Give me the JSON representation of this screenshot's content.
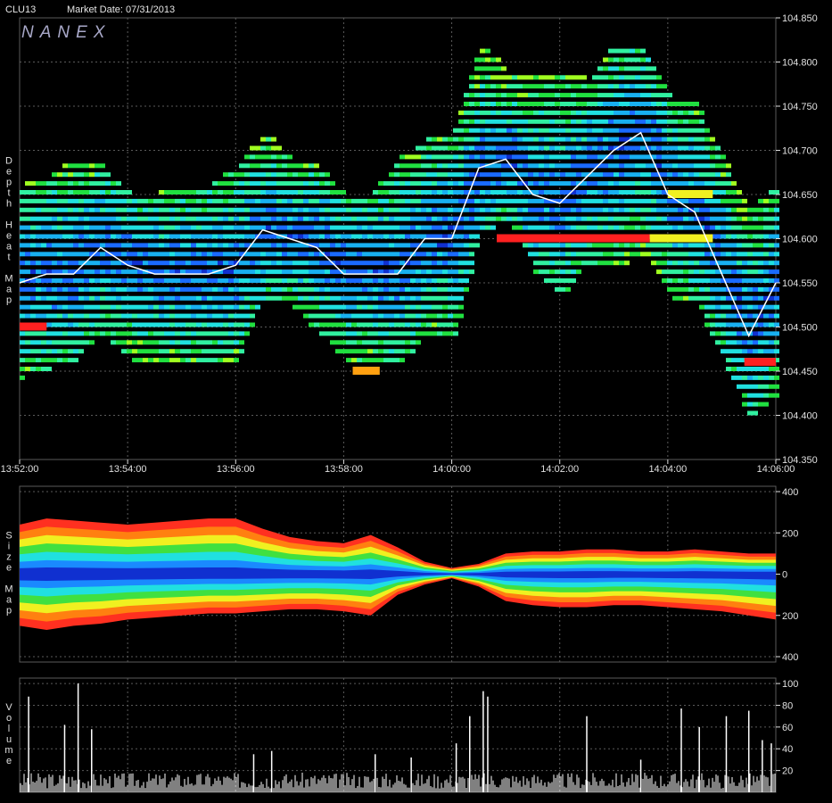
{
  "header": {
    "symbol": "CLU13",
    "market_date": "Market Date: 07/31/2013",
    "logo": "NANEX"
  },
  "colors": {
    "background": "#000000",
    "grid": "#5a5a5a",
    "axis_text": "#e0e0e0",
    "last_trade_line": "#ffffff",
    "heat_scale": [
      "#1030d0",
      "#1a6aff",
      "#18b0f0",
      "#20e0e0",
      "#30f0a0",
      "#20e040",
      "#a0ff20",
      "#f0f020",
      "#ffa010",
      "#ff2020"
    ]
  },
  "chart_data": [
    {
      "type": "heatmap",
      "panel": "depth",
      "ylabel": "Depth Heat Map",
      "ylim": [
        104.35,
        104.85
      ],
      "y_ticks": [
        "104.350",
        "104.400",
        "104.450",
        "104.500",
        "104.550",
        "104.600",
        "104.650",
        "104.700",
        "104.750",
        "104.800",
        "104.850"
      ],
      "x_ticks": [
        "13:52:00",
        "13:54:00",
        "13:56:00",
        "13:58:00",
        "14:00:00",
        "14:02:00",
        "14:04:00",
        "14:06:00"
      ],
      "last_trade_line": {
        "time": [
          "13:52:00",
          "13:52:30",
          "13:53:00",
          "13:53:30",
          "13:54:00",
          "13:54:30",
          "13:55:00",
          "13:55:30",
          "13:56:00",
          "13:56:30",
          "13:57:00",
          "13:57:30",
          "13:58:00",
          "13:58:30",
          "13:59:00",
          "13:59:30",
          "14:00:00",
          "14:00:30",
          "14:01:00",
          "14:01:30",
          "14:02:00",
          "14:02:30",
          "14:03:00",
          "14:03:30",
          "14:04:00",
          "14:04:30",
          "14:05:00",
          "14:05:30",
          "14:06:00"
        ],
        "price": [
          104.55,
          104.56,
          104.56,
          104.59,
          104.57,
          104.56,
          104.56,
          104.56,
          104.57,
          104.61,
          104.6,
          104.59,
          104.56,
          104.56,
          104.56,
          104.6,
          104.6,
          104.68,
          104.69,
          104.65,
          104.64,
          104.67,
          104.7,
          104.72,
          104.65,
          104.63,
          104.56,
          104.49,
          104.55
        ]
      },
      "depth_range": {
        "time": [
          "13:52:00",
          "13:52:30",
          "13:53:00",
          "13:53:30",
          "13:54:00",
          "13:54:30",
          "13:55:00",
          "13:55:30",
          "13:56:00",
          "13:56:30",
          "13:57:00",
          "13:57:30",
          "13:58:00",
          "13:58:30",
          "13:59:00",
          "13:59:30",
          "14:00:00",
          "14:00:30",
          "14:01:00",
          "14:01:30",
          "14:02:00",
          "14:02:30",
          "14:03:00",
          "14:03:30",
          "14:04:00",
          "14:04:30",
          "14:05:00",
          "14:05:30",
          "14:06:00"
        ],
        "low": [
          104.44,
          104.45,
          104.46,
          104.49,
          104.46,
          104.46,
          104.46,
          104.45,
          104.46,
          104.53,
          104.52,
          104.49,
          104.46,
          104.46,
          104.45,
          104.49,
          104.48,
          104.6,
          104.62,
          104.56,
          104.53,
          104.57,
          104.56,
          104.58,
          104.53,
          104.52,
          104.46,
          104.39,
          104.42
        ],
        "high": [
          104.66,
          104.67,
          104.69,
          104.68,
          104.65,
          104.65,
          104.66,
          104.66,
          104.68,
          104.72,
          104.69,
          104.68,
          104.65,
          104.65,
          104.69,
          104.71,
          104.72,
          104.82,
          104.79,
          104.78,
          104.79,
          104.78,
          104.82,
          104.81,
          104.76,
          104.75,
          104.69,
          104.63,
          104.66
        ]
      },
      "highlight_bands": [
        {
          "from": "13:52:00",
          "to": "13:52:30",
          "price": 104.5,
          "color": "#ff2020"
        },
        {
          "from": "13:58:10",
          "to": "13:58:40",
          "price": 104.45,
          "color": "#ffa010"
        },
        {
          "from": "14:00:50",
          "to": "14:03:40",
          "price": 104.6,
          "color": "#ff2020"
        },
        {
          "from": "14:03:40",
          "to": "14:04:50",
          "price": 104.6,
          "color": "#f0f020"
        },
        {
          "from": "14:04:00",
          "to": "14:04:50",
          "price": 104.65,
          "color": "#f0f020"
        },
        {
          "from": "14:05:25",
          "to": "14:06:00",
          "price": 104.46,
          "color": "#ff2020"
        }
      ]
    },
    {
      "type": "area",
      "panel": "size",
      "ylabel": "Size Map",
      "ylim": [
        -400,
        400
      ],
      "y_ticks": [
        "400",
        "200",
        "0",
        "200",
        "400"
      ],
      "y_tick_values": [
        400,
        200,
        0,
        -200,
        -400
      ],
      "time": [
        "13:52:00",
        "13:52:30",
        "13:53:00",
        "13:53:30",
        "13:54:00",
        "13:54:30",
        "13:55:00",
        "13:55:30",
        "13:56:00",
        "13:56:30",
        "13:57:00",
        "13:57:30",
        "13:58:00",
        "13:58:30",
        "13:59:00",
        "13:59:30",
        "14:00:00",
        "14:00:30",
        "14:01:00",
        "14:01:30",
        "14:02:00",
        "14:02:30",
        "14:03:00",
        "14:03:30",
        "14:04:00",
        "14:04:30",
        "14:05:00",
        "14:05:30",
        "14:06:00"
      ],
      "bid_size": [
        240,
        270,
        260,
        250,
        240,
        250,
        260,
        270,
        270,
        220,
        180,
        160,
        150,
        190,
        130,
        60,
        30,
        50,
        100,
        110,
        110,
        120,
        120,
        110,
        110,
        120,
        110,
        100,
        100
      ],
      "ask_size": [
        -250,
        -270,
        -250,
        -240,
        -220,
        -210,
        -200,
        -190,
        -190,
        -180,
        -170,
        -170,
        -180,
        -200,
        -100,
        -50,
        -20,
        -60,
        -130,
        -150,
        -160,
        -160,
        -150,
        -150,
        -160,
        -170,
        -180,
        -200,
        -220
      ]
    },
    {
      "type": "bar",
      "panel": "volume",
      "ylabel": "Volume",
      "ylim": [
        0,
        105
      ],
      "y_ticks": [
        "100",
        "80",
        "60",
        "40",
        "20"
      ],
      "y_tick_values": [
        100,
        80,
        60,
        40,
        20
      ],
      "spikes": [
        {
          "time": "13:52:10",
          "value": 88
        },
        {
          "time": "13:52:50",
          "value": 62
        },
        {
          "time": "13:53:05",
          "value": 100
        },
        {
          "time": "13:53:20",
          "value": 58
        },
        {
          "time": "13:56:20",
          "value": 35
        },
        {
          "time": "13:56:40",
          "value": 38
        },
        {
          "time": "13:58:35",
          "value": 35
        },
        {
          "time": "13:59:15",
          "value": 32
        },
        {
          "time": "14:00:05",
          "value": 45
        },
        {
          "time": "14:00:20",
          "value": 70
        },
        {
          "time": "14:00:35",
          "value": 93
        },
        {
          "time": "14:00:40",
          "value": 88
        },
        {
          "time": "14:02:30",
          "value": 70
        },
        {
          "time": "14:03:30",
          "value": 30
        },
        {
          "time": "14:04:15",
          "value": 77
        },
        {
          "time": "14:04:35",
          "value": 60
        },
        {
          "time": "14:05:05",
          "value": 70
        },
        {
          "time": "14:05:30",
          "value": 75
        },
        {
          "time": "14:05:45",
          "value": 48
        },
        {
          "time": "14:05:55",
          "value": 45
        }
      ],
      "baseline_typical": 12
    }
  ]
}
